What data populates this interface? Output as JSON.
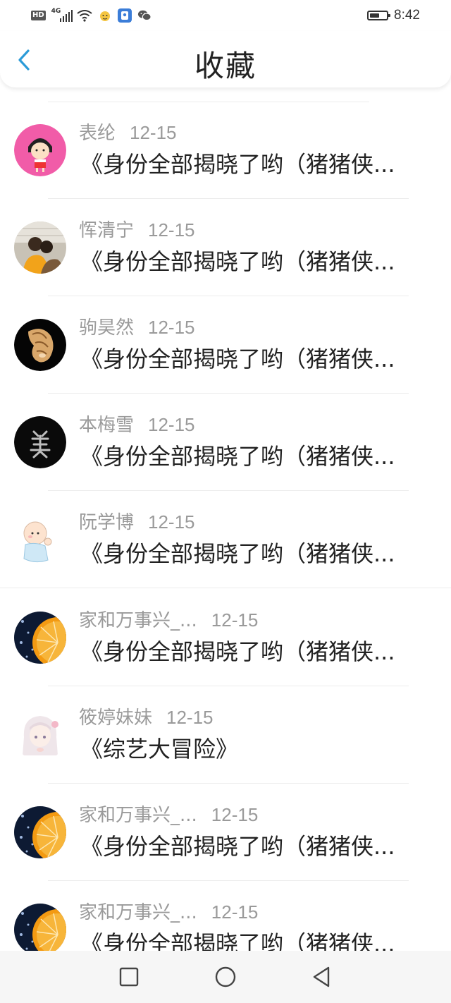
{
  "status_bar": {
    "hd_label": "HD",
    "network_label": "4G",
    "time": "8:42"
  },
  "header": {
    "title": "收藏"
  },
  "items": [
    {
      "name": "表纶",
      "date": "12-15",
      "title": "《身份全部揭晓了哟（猪猪侠..."
    },
    {
      "name": "恽清宁",
      "date": "12-15",
      "title": "《身份全部揭晓了哟（猪猪侠..."
    },
    {
      "name": "驹昊然",
      "date": "12-15",
      "title": "《身份全部揭晓了哟（猪猪侠..."
    },
    {
      "name": "本梅雪",
      "date": "12-15",
      "title": "《身份全部揭晓了哟（猪猪侠..."
    },
    {
      "name": "阮学博",
      "date": "12-15",
      "title": "《身份全部揭晓了哟（猪猪侠..."
    },
    {
      "name": "家和万事兴_...",
      "date": "12-15",
      "title": "《身份全部揭晓了哟（猪猪侠..."
    },
    {
      "name": "筱婷妹妹",
      "date": "12-15",
      "title": "《综艺大冒险》"
    },
    {
      "name": "家和万事兴_...",
      "date": "12-15",
      "title": "《身份全部揭晓了哟（猪猪侠..."
    },
    {
      "name": "家和万事兴_...",
      "date": "12-15",
      "title": "《身份全部揭晓了哟（猪猪侠..."
    }
  ],
  "avatar_icons": [
    "cartoon-girl-avatar",
    "people-photo-avatar",
    "seashell-avatar",
    "calligraphy-character-avatar",
    "baby-cartoon-avatar",
    "orange-slice-avatar",
    "anime-girl-avatar",
    "orange-slice-avatar",
    "orange-slice-avatar"
  ],
  "colors": {
    "accent": "#2b9bd8",
    "text_primary": "#222222",
    "text_secondary": "#9a9a9a"
  }
}
